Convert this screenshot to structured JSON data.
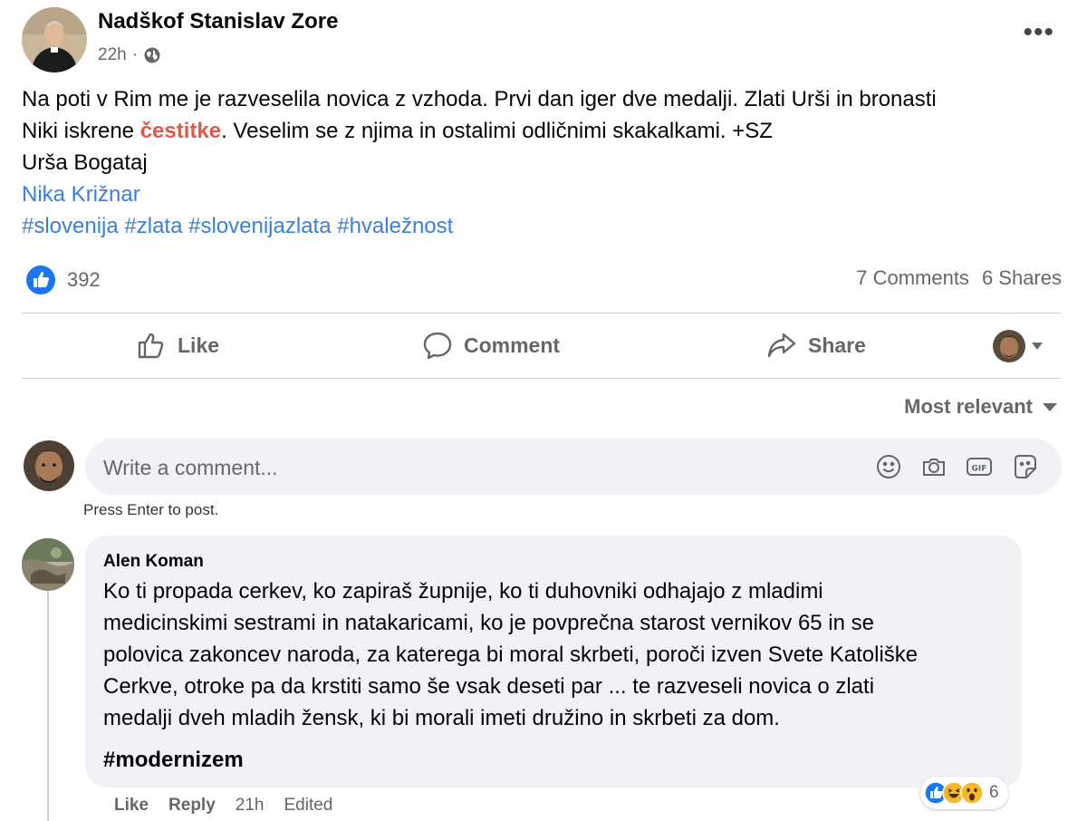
{
  "post": {
    "author": "Nadškof Stanislav Zore",
    "time": "22h",
    "privacy_icon": "globe-icon",
    "more_label": "•••",
    "text": {
      "line1": "Na poti v Rim me je razveselila novica z vzhoda. Prvi dan iger dve medalji. Zlati Urši in bronasti",
      "line2_pre": "Niki iskrene ",
      "line2_hl": "čestitke",
      "line2_post": ". Veselim se z njima in ostalimi odličnimi skakalkami. +SZ",
      "line3": "Urša Bogataj",
      "line4_link": "Nika Križnar",
      "hashtags": [
        "#slovenija",
        "#zlata",
        "#slovenijazlata",
        "#hvaležnost"
      ]
    },
    "reactions_count": "392",
    "comments_count": "7 Comments",
    "shares_count": "6 Shares"
  },
  "actions": {
    "like": "Like",
    "comment": "Comment",
    "share": "Share"
  },
  "comments_section": {
    "sort_label": "Most relevant",
    "input_placeholder": "Write a comment...",
    "hint": "Press Enter to post."
  },
  "comment": {
    "author": "Alen Koman",
    "lines": [
      "Ko ti propada cerkev, ko zapiraš župnije, ko ti duhovniki odhajajo z mladimi",
      "medicinskimi sestrami in natakaricami, ko je povprečna starost vernikov 65 in se",
      "polovica zakoncev naroda, za katerega bi moral skrbeti, poroči izven Svete Katoliške",
      "Cerkve, otroke pa da krstiti samo še vsak deseti par ... te razveseli novica o zlati",
      "medalji dveh mladih žensk, ki bi morali imeti družino in skrbeti za dom."
    ],
    "hashtag": "#modernizem",
    "reaction_count": "6",
    "like": "Like",
    "reply": "Reply",
    "time": "21h",
    "edited": "Edited"
  },
  "colors": {
    "like_blue": "#1877f2",
    "link_blue": "#3a7fe0",
    "highlight_red": "#e4584a",
    "secondary_text": "#65676b"
  }
}
